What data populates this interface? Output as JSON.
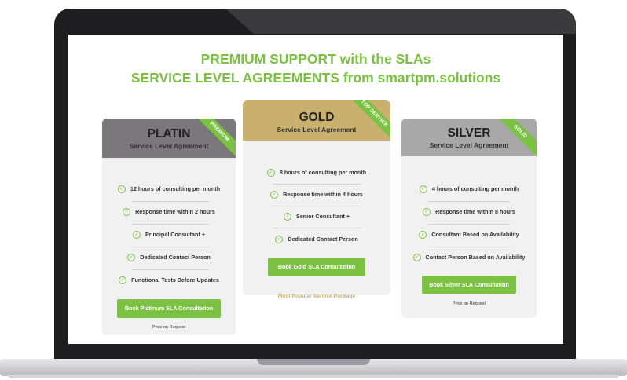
{
  "headline": {
    "line1": "PREMIUM SUPPORT with the SLAs",
    "line2": "SERVICE LEVEL AGREEMENTS from smartpm.solutions"
  },
  "colors": {
    "accent_green": "#7bc142",
    "platin_header": "#7b787b",
    "gold_header": "#c9b06f",
    "silver_header": "#a8a8a8",
    "card_bg": "#f1f1f1",
    "popular_text": "#c9b06f"
  },
  "icons": {
    "feature_check": "check-circle-icon"
  },
  "plans": {
    "platin": {
      "title": "PLATIN",
      "subtitle": "Service Level Agreement",
      "ribbon": "PREMIUM",
      "features": [
        "12 hours of consulting per month",
        "Response time within 2 hours",
        "Principal Consultant +",
        "Dedicated Contact Person",
        "Functional Tests Before Updates"
      ],
      "cta": "Book Platinum SLA Consultation",
      "note": "Price on Request"
    },
    "gold": {
      "title": "GOLD",
      "subtitle": "Service Level Agreement",
      "ribbon": "TOP SERVICE",
      "features": [
        "8 hours of consulting per month",
        "Response time within 4 hours",
        "Senior Consultant +",
        "Dedicated Contact Person"
      ],
      "cta": "Book Gold SLA Consultation",
      "note": "Most Popular Service Package"
    },
    "silver": {
      "title": "SILVER",
      "subtitle": "Service Level Agreement",
      "ribbon": "SOLID",
      "features": [
        "4 hours of consulting per month",
        "Response time within 8 hours",
        "Consultant Based on Availability",
        "Contact Person Based on Availability"
      ],
      "cta": "Book Silver SLA Consultation",
      "note": "Price on Request"
    }
  }
}
